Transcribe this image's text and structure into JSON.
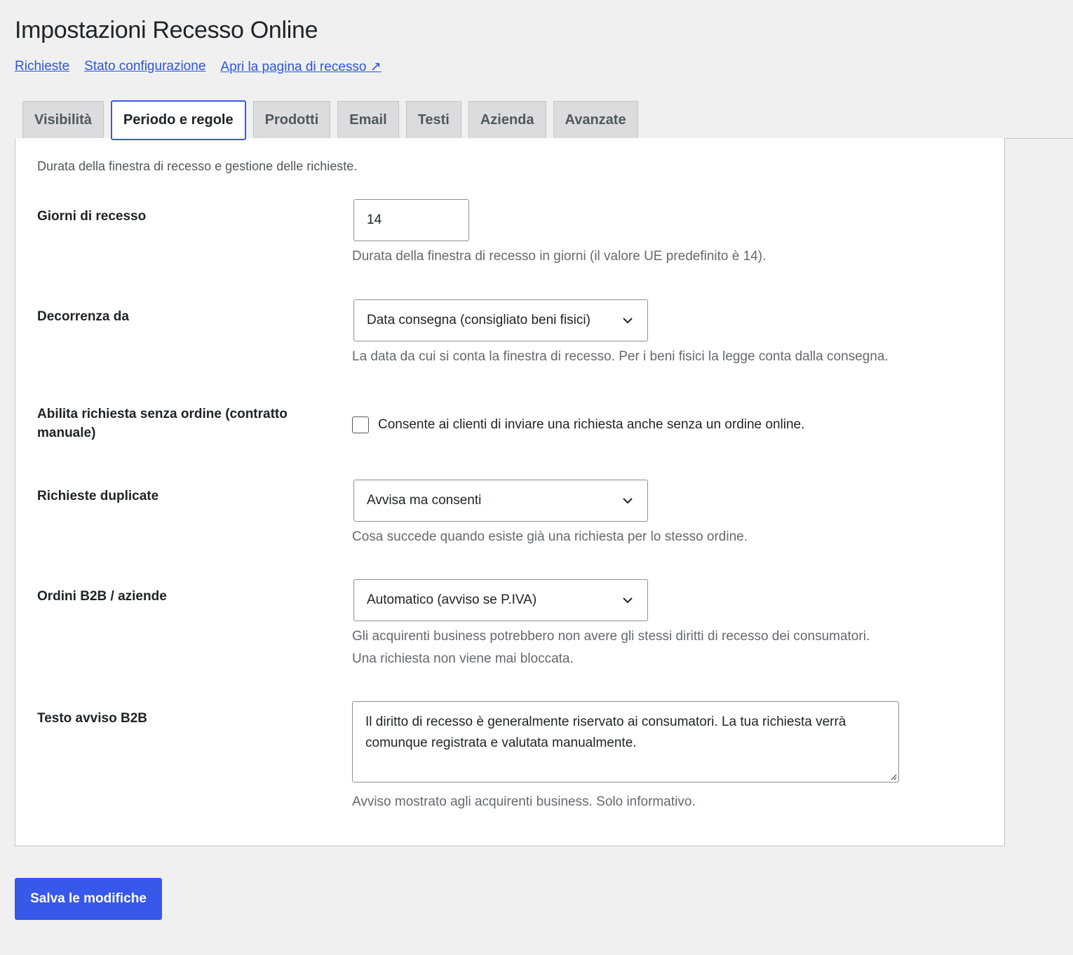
{
  "header": {
    "title": "Impostazioni Recesso Online",
    "links": [
      "Richieste",
      "Stato configurazione",
      "Apri la pagina di recesso ↗"
    ]
  },
  "tabs": [
    {
      "label": "Visibilità",
      "active": false
    },
    {
      "label": "Periodo e regole",
      "active": true
    },
    {
      "label": "Prodotti",
      "active": false
    },
    {
      "label": "Email",
      "active": false
    },
    {
      "label": "Testi",
      "active": false
    },
    {
      "label": "Azienda",
      "active": false
    },
    {
      "label": "Avanzate",
      "active": false
    }
  ],
  "panel": {
    "intro": "Durata della finestra di recesso e gestione delle richieste.",
    "giorni": {
      "label": "Giorni di recesso",
      "value": "14",
      "desc": "Durata della finestra di recesso in giorni (il valore UE predefinito è 14)."
    },
    "decorrenza": {
      "label": "Decorrenza da",
      "value": "Data consegna (consigliato beni fisici)",
      "desc": "La data da cui si conta la finestra di recesso. Per i beni fisici la legge conta dalla consegna."
    },
    "senza_ordine": {
      "label": "Abilita richiesta senza ordine (contratto manuale)",
      "checkbox_label": "Consente ai clienti di inviare una richiesta anche senza un ordine online.",
      "checked": false
    },
    "duplicate": {
      "label": "Richieste duplicate",
      "value": "Avvisa ma consenti",
      "desc": "Cosa succede quando esiste già una richiesta per lo stesso ordine."
    },
    "b2b": {
      "label": "Ordini B2B / aziende",
      "value": "Automatico (avviso se P.IVA)",
      "desc_1": "Gli acquirenti business potrebbero non avere gli stessi diritti di recesso dei consumatori.",
      "desc_2": "Una richiesta non viene mai bloccata."
    },
    "testo_b2b": {
      "label": "Testo avviso B2B",
      "value": "Il diritto di recesso è generalmente riservato ai consumatori. La tua richiesta verrà comunque registrata e valutata manualmente.",
      "desc": "Avviso mostrato agli acquirenti business. Solo informativo."
    }
  },
  "save_label": "Salva le modifiche",
  "colors": {
    "accent": "#3858e9",
    "link": "#2b55e0",
    "background": "#f0f0f1"
  }
}
